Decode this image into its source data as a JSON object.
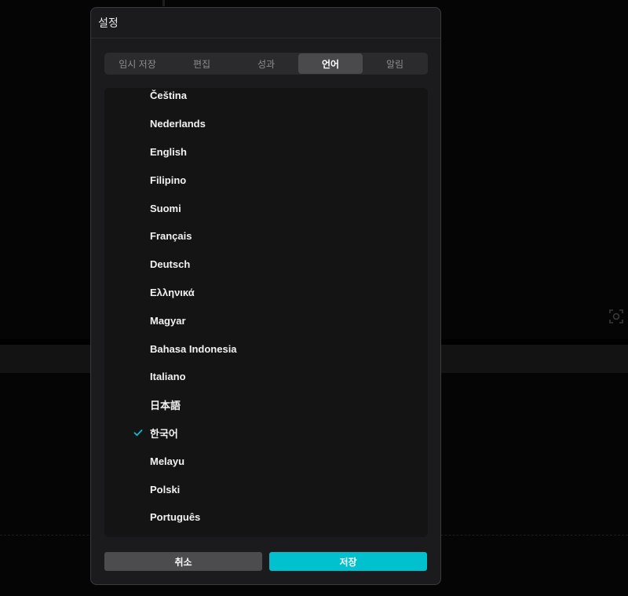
{
  "dialog": {
    "title": "설정",
    "tabs": [
      {
        "label": "임시 저장",
        "active": false
      },
      {
        "label": "편집",
        "active": false
      },
      {
        "label": "성과",
        "active": false
      },
      {
        "label": "언어",
        "active": true
      },
      {
        "label": "알림",
        "active": false
      }
    ],
    "languages": [
      {
        "label": "Čeština",
        "selected": false
      },
      {
        "label": "Nederlands",
        "selected": false
      },
      {
        "label": "English",
        "selected": false
      },
      {
        "label": "Filipino",
        "selected": false
      },
      {
        "label": "Suomi",
        "selected": false
      },
      {
        "label": "Français",
        "selected": false
      },
      {
        "label": "Deutsch",
        "selected": false
      },
      {
        "label": "Ελληνικά",
        "selected": false
      },
      {
        "label": "Magyar",
        "selected": false
      },
      {
        "label": "Bahasa Indonesia",
        "selected": false
      },
      {
        "label": "Italiano",
        "selected": false
      },
      {
        "label": "日本語",
        "selected": false
      },
      {
        "label": "한국어",
        "selected": true
      },
      {
        "label": "Melayu",
        "selected": false
      },
      {
        "label": "Polski",
        "selected": false
      },
      {
        "label": "Português",
        "selected": false
      }
    ],
    "cancel_label": "취소",
    "save_label": "저장"
  },
  "colors": {
    "accent": "#00c1cd",
    "dialog_bg": "#1b1b1d",
    "list_bg": "#141414",
    "tab_active": "#4a4a4d"
  },
  "icons": {
    "selected_marker": "check-icon",
    "background_tool": "focus-frame-icon"
  }
}
